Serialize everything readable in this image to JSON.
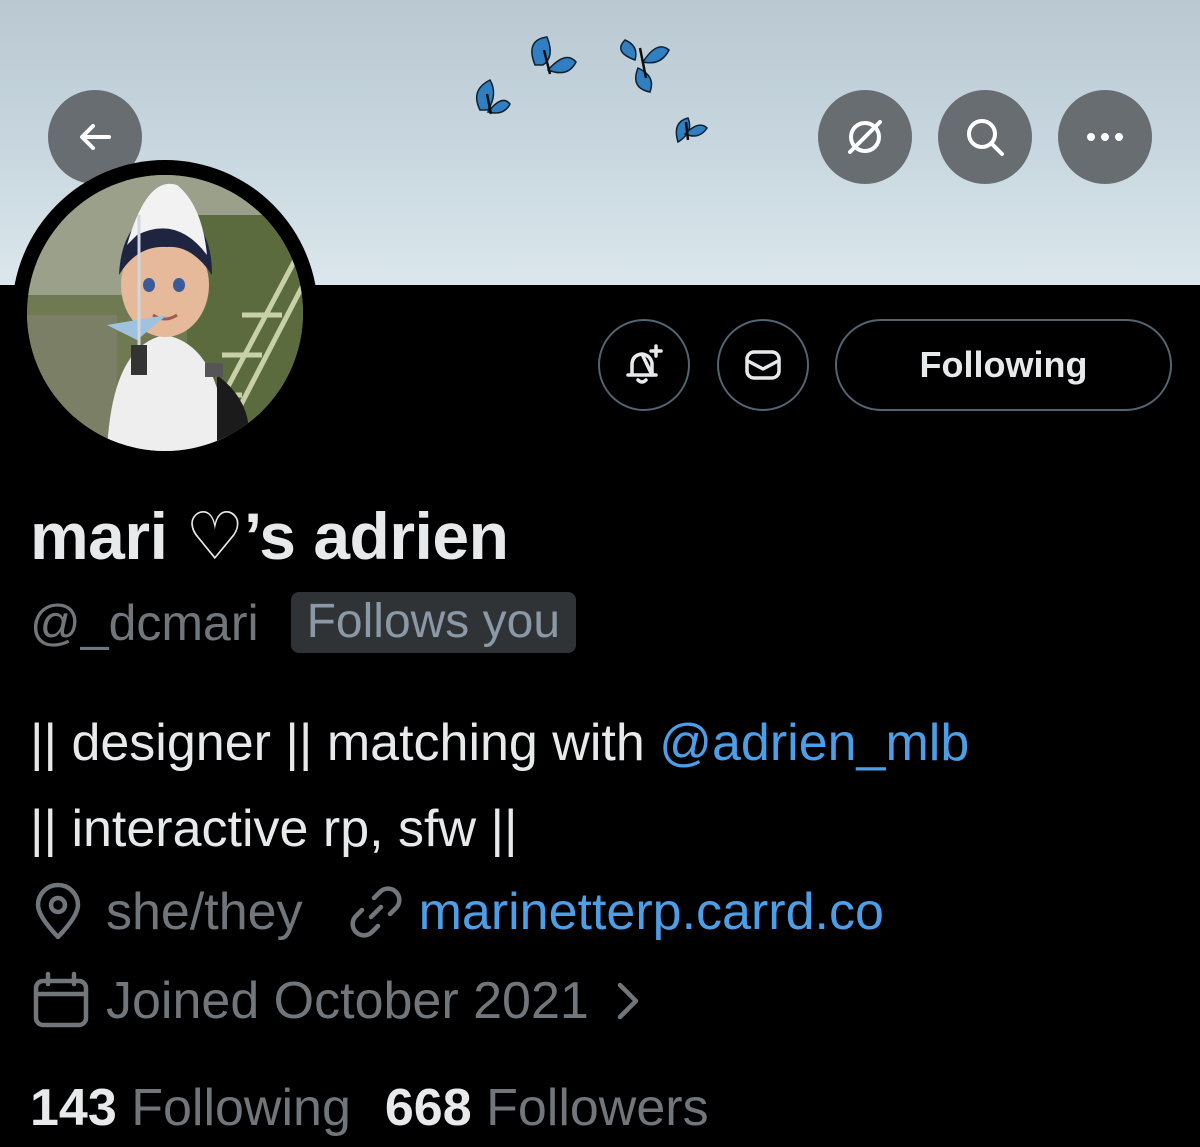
{
  "profile": {
    "display_name": "mari ♡’s adrien",
    "handle": "@_dcmari",
    "follows_you_label": "Follows you",
    "bio_line1_prefix": "|| designer || matching with ",
    "bio_mention": "@adrien_mlb",
    "bio_line2": "|| interactive rp, sfw ||",
    "location": "she/they",
    "website": "marinetterp.carrd.co",
    "joined": "Joined October 2021",
    "following_count": "143",
    "following_label": "Following",
    "followers_count": "668",
    "followers_label": "Followers"
  },
  "actions": {
    "following_button": "Following"
  },
  "icons": {
    "back": "arrow-left-icon",
    "grok": "grok-icon",
    "search": "search-icon",
    "more": "more-icon",
    "notify": "bell-plus-icon",
    "message": "envelope-icon",
    "location": "location-pin-icon",
    "link": "link-icon",
    "calendar": "calendar-icon",
    "chevron": "chevron-right-icon"
  },
  "colors": {
    "background": "#000000",
    "text_primary": "#e7e9ea",
    "text_secondary": "#71767b",
    "accent": "#4c9ee6",
    "badge_bg": "#2f3336",
    "button_border": "#536471"
  }
}
